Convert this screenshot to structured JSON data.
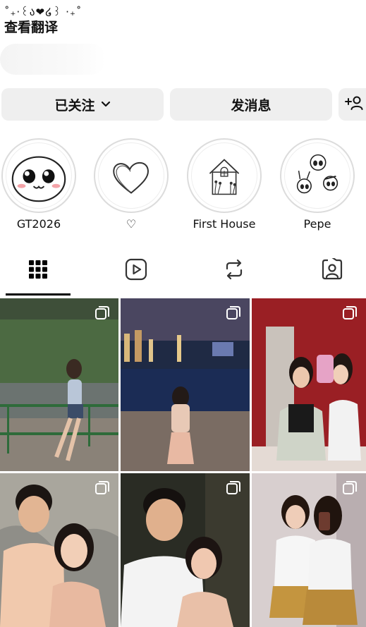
{
  "bio": {
    "deco_line": "˚₊‧꒰ა❤໒꒱ ‧₊˚",
    "translate_label": "查看翻译"
  },
  "actions": {
    "following_label": "已关注",
    "message_label": "发消息",
    "following_icon": "chevron-down-icon",
    "add_person_icon": "add-person-icon"
  },
  "highlights": [
    {
      "label": "GT2026",
      "icon": "cute-face-sticker"
    },
    {
      "label": "♡",
      "icon": "heart-doodle"
    },
    {
      "label": "First House",
      "icon": "house-doodle"
    },
    {
      "label": "Pepe",
      "icon": "powerpuff-doodle"
    }
  ],
  "tabs": [
    {
      "name": "grid",
      "icon": "grid-icon",
      "selected": true
    },
    {
      "name": "reels",
      "icon": "reels-icon",
      "selected": false
    },
    {
      "name": "reposts",
      "icon": "repost-icon",
      "selected": false
    },
    {
      "name": "tagged",
      "icon": "tagged-person-icon",
      "selected": false
    }
  ],
  "posts": [
    {
      "scene": "woman posing by railing at street",
      "multi": true
    },
    {
      "scene": "woman at rooftop pool with city skyline at night",
      "multi": true
    },
    {
      "scene": "two women mirror selfie in red restroom",
      "multi": true
    },
    {
      "scene": "couple smiling in cave",
      "multi": true
    },
    {
      "scene": "couple selfie at night",
      "multi": true
    },
    {
      "scene": "two girls in school uniforms",
      "multi": true
    }
  ],
  "colors": {
    "button_bg": "#efefef",
    "ring": "#dcdcdc",
    "text": "#111111"
  }
}
